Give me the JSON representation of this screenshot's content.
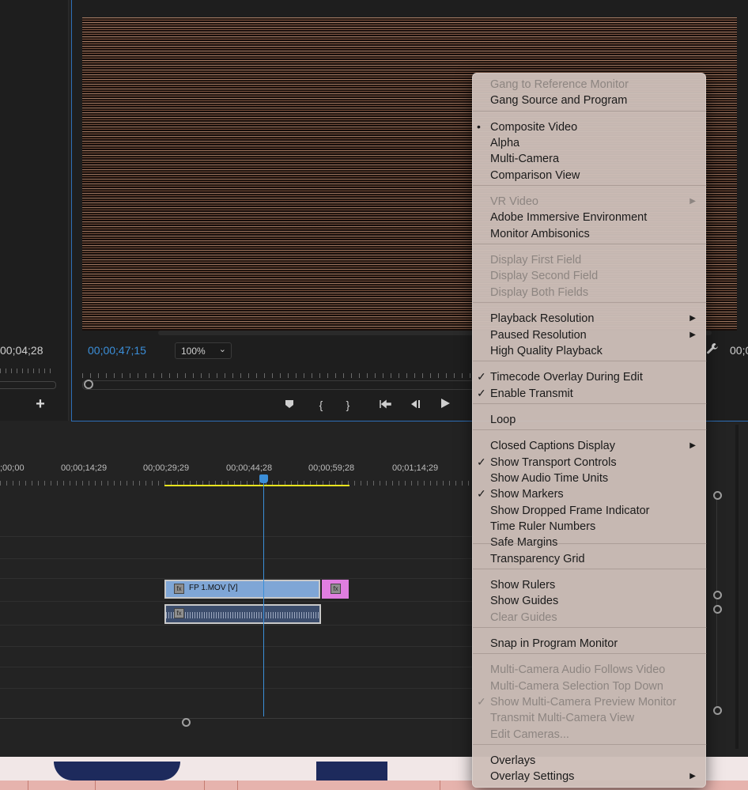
{
  "source_monitor": {
    "timecode": "00;04;28",
    "add_symbol": "+"
  },
  "program_monitor": {
    "timecode": "00;00;47;15",
    "zoom": "100%",
    "end_timecode": "00;0",
    "icons": {
      "wrench": "wrench-icon",
      "zoom_chevron": "chevron-down-icon"
    }
  },
  "transport": [
    {
      "name": "add-marker-button",
      "icon": "⬟"
    },
    {
      "name": "mark-in-button",
      "icon": "{"
    },
    {
      "name": "mark-out-button",
      "icon": "}"
    },
    {
      "name": "go-to-in-button",
      "icon": "{←"
    },
    {
      "name": "step-back-button",
      "icon": "◀|"
    },
    {
      "name": "play-button",
      "icon": "▶"
    }
  ],
  "timeline": {
    "ruler_labels": [
      ";00;00",
      "00;00;14;29",
      "00;00;29;29",
      "00;00;44;28",
      "00;00;59;28",
      "00;01;14;29"
    ],
    "video_clip": {
      "name": "FP 1.MOV [V]",
      "fx": "fx"
    },
    "transition_fx": "fx",
    "audio_fx": "fx",
    "colors": {
      "playhead": "#3b8ed8",
      "work_area": "#e8e41e",
      "video_clip": "#7fa6d6",
      "transition": "#e07ee0"
    }
  },
  "context_menu": {
    "items": [
      {
        "label": "Gang to Reference Monitor",
        "disabled": true
      },
      {
        "label": "Gang Source and Program"
      },
      {
        "label": "Composite Video",
        "mark": "•"
      },
      {
        "label": "Alpha"
      },
      {
        "label": "Multi-Camera"
      },
      {
        "label": "Comparison View"
      },
      {
        "label": "VR Video",
        "disabled": true,
        "submenu": true
      },
      {
        "label": "Adobe Immersive Environment"
      },
      {
        "label": "Monitor Ambisonics"
      },
      {
        "label": "Display First Field",
        "disabled": true
      },
      {
        "label": "Display Second Field",
        "disabled": true
      },
      {
        "label": "Display Both Fields",
        "disabled": true
      },
      {
        "label": "Playback Resolution",
        "submenu": true
      },
      {
        "label": "Paused Resolution",
        "submenu": true
      },
      {
        "label": "High Quality Playback"
      },
      {
        "label": "Timecode Overlay During Edit",
        "mark": "✓"
      },
      {
        "label": "Enable Transmit",
        "mark": "✓"
      },
      {
        "label": "Loop"
      },
      {
        "label": "Closed Captions Display",
        "submenu": true
      },
      {
        "label": "Show Transport Controls",
        "mark": "✓"
      },
      {
        "label": "Show Audio Time Units"
      },
      {
        "label": "Show Markers",
        "mark": "✓"
      },
      {
        "label": "Show Dropped Frame Indicator"
      },
      {
        "label": "Time Ruler Numbers"
      },
      {
        "label": "Safe Margins"
      },
      {
        "label": "Transparency Grid"
      },
      {
        "label": "Show Rulers"
      },
      {
        "label": "Show Guides"
      },
      {
        "label": "Clear Guides",
        "disabled": true
      },
      {
        "label": "Snap in Program Monitor"
      },
      {
        "label": "Multi-Camera Audio Follows Video",
        "disabled": true
      },
      {
        "label": "Multi-Camera Selection Top Down",
        "disabled": true
      },
      {
        "label": "Show Multi-Camera Preview Monitor",
        "disabled": true,
        "mark": "✓"
      },
      {
        "label": "Transmit Multi-Camera View",
        "disabled": true
      },
      {
        "label": "Edit Cameras...",
        "disabled": true
      },
      {
        "label": "Overlays"
      },
      {
        "label": "Overlay Settings",
        "submenu": true
      }
    ]
  }
}
